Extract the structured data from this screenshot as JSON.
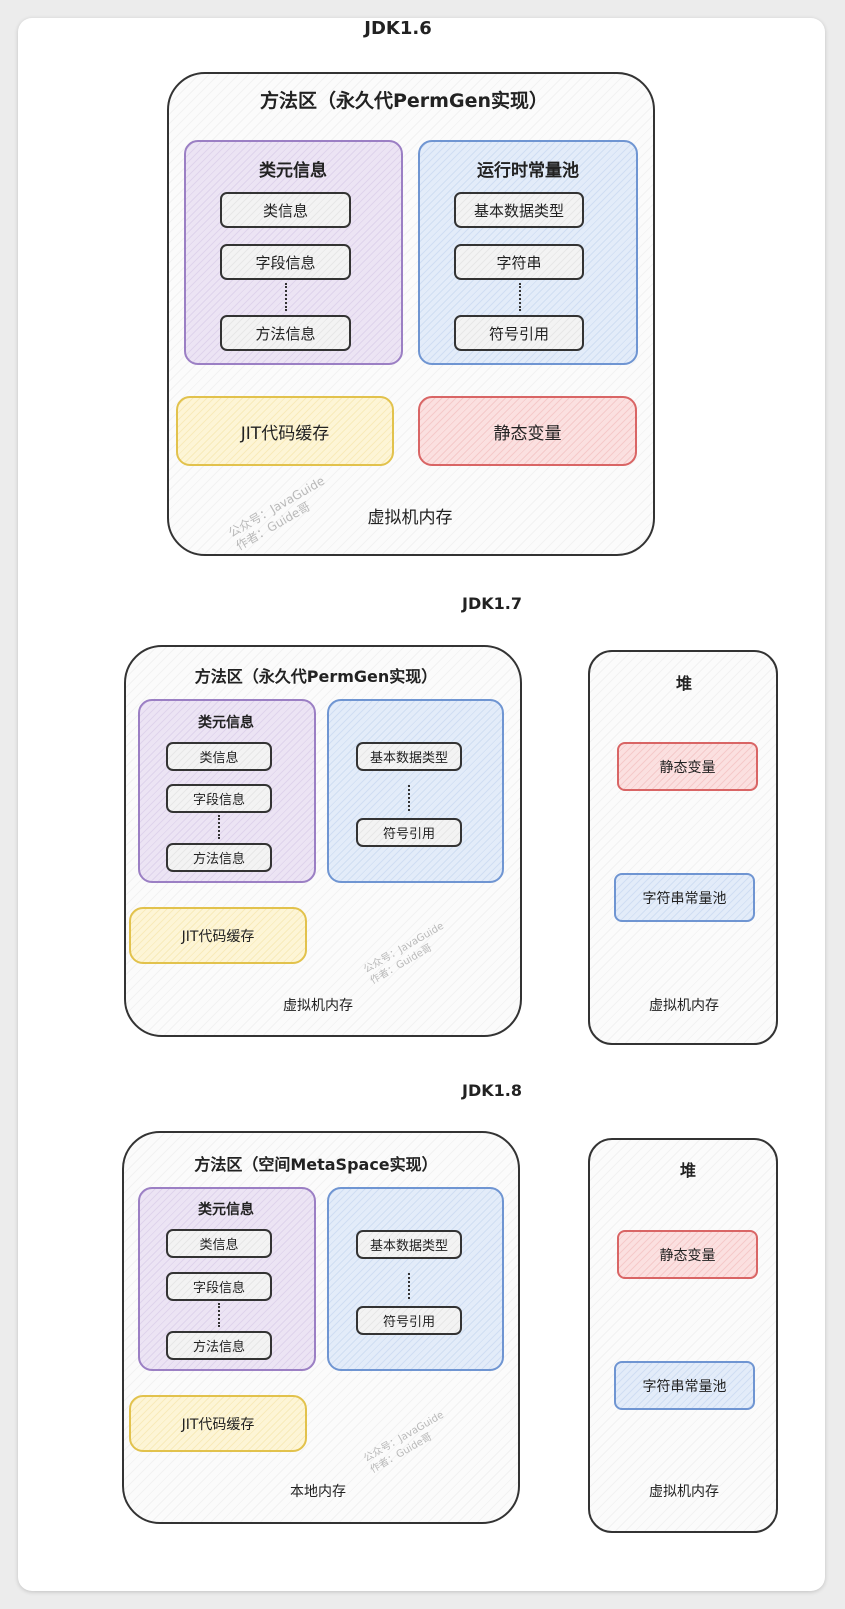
{
  "watermark": {
    "line1": "公众号：JavaGuide",
    "line2": "作者：Guide哥"
  },
  "jdk16": {
    "title": "JDK1.6",
    "method_area": "方法区（永久代PermGen实现）",
    "class_meta": {
      "title": "类元信息",
      "items": [
        "类信息",
        "字段信息",
        "方法信息"
      ]
    },
    "const_pool": {
      "title": "运行时常量池",
      "items": [
        "基本数据类型",
        "字符串",
        "符号引用"
      ]
    },
    "jit": "JIT代码缓存",
    "static_vars": "静态变量",
    "region_label": "虚拟机内存"
  },
  "jdk17": {
    "title": "JDK1.7",
    "method_area": "方法区（永久代PermGen实现）",
    "class_meta": {
      "title": "类元信息",
      "items": [
        "类信息",
        "字段信息",
        "方法信息"
      ]
    },
    "const_pool": {
      "items": [
        "基本数据类型",
        "符号引用"
      ]
    },
    "jit": "JIT代码缓存",
    "region_label": "虚拟机内存",
    "heap": {
      "title": "堆",
      "static_vars": "静态变量",
      "string_pool": "字符串常量池",
      "region_label": "虚拟机内存"
    }
  },
  "jdk18": {
    "title": "JDK1.8",
    "method_area": "方法区（空间MetaSpace实现）",
    "class_meta": {
      "title": "类元信息",
      "items": [
        "类信息",
        "字段信息",
        "方法信息"
      ]
    },
    "const_pool": {
      "items": [
        "基本数据类型",
        "符号引用"
      ]
    },
    "jit": "JIT代码缓存",
    "region_label": "本地内存",
    "heap": {
      "title": "堆",
      "static_vars": "静态变量",
      "string_pool": "字符串常量池",
      "region_label": "虚拟机内存"
    }
  }
}
